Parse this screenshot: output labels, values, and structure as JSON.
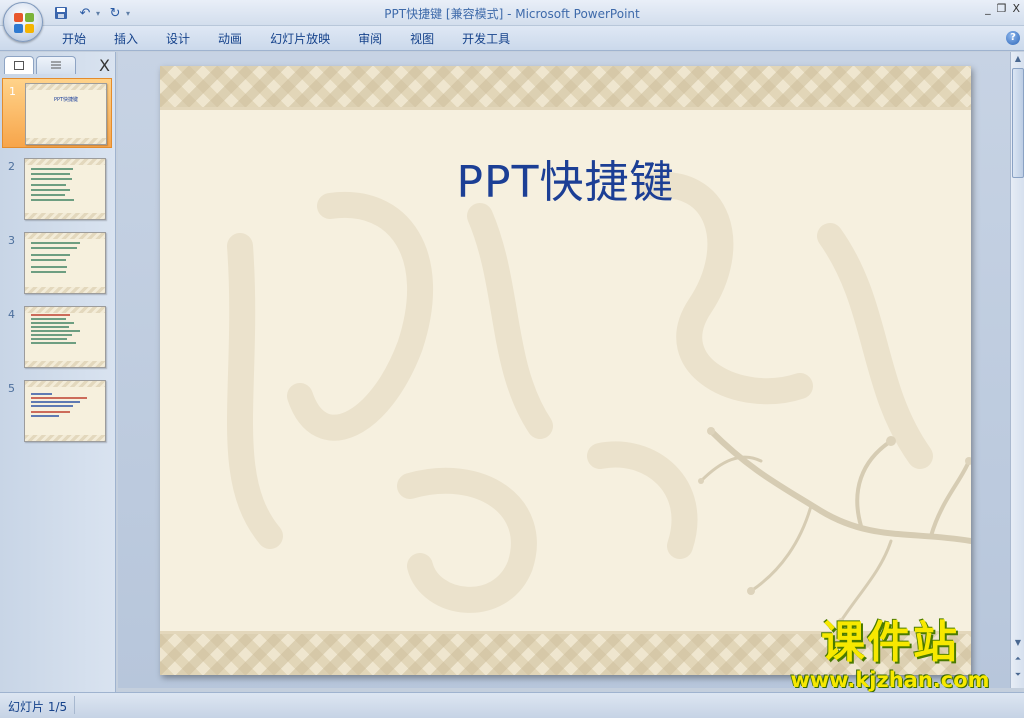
{
  "window": {
    "doc_name": "PPT快捷键 [兼容模式]",
    "separator": " - ",
    "app_name": "Microsoft PowerPoint",
    "controls": [
      "_",
      "❐",
      "X"
    ]
  },
  "quick_access": {
    "save_icon": "save-icon",
    "undo_icon": "undo-icon",
    "redo_icon": "redo-icon",
    "customize_icon": "customize-qat-icon"
  },
  "ribbon": {
    "tabs": [
      "开始",
      "插入",
      "设计",
      "动画",
      "幻灯片放映",
      "审阅",
      "视图",
      "开发工具"
    ],
    "help_label": "?"
  },
  "thumbnail_pane": {
    "close_label": "X",
    "slides": [
      {
        "number": "1",
        "title": "PPT快捷键",
        "selected": true
      },
      {
        "number": "2",
        "selected": false
      },
      {
        "number": "3",
        "selected": false
      },
      {
        "number": "4",
        "selected": false
      },
      {
        "number": "5",
        "selected": false
      }
    ]
  },
  "slide": {
    "title": "PPT快捷键"
  },
  "watermark": {
    "name": "课件站",
    "url": "www.kjzhan.com"
  },
  "status_bar": {
    "slide_indicator": "幻灯片 1/5"
  },
  "colors": {
    "slide_title": "#1c3f95",
    "selected_thumb": "#f7a54b",
    "watermark_text": "#f7e800",
    "ribbon_text": "#15428b"
  }
}
